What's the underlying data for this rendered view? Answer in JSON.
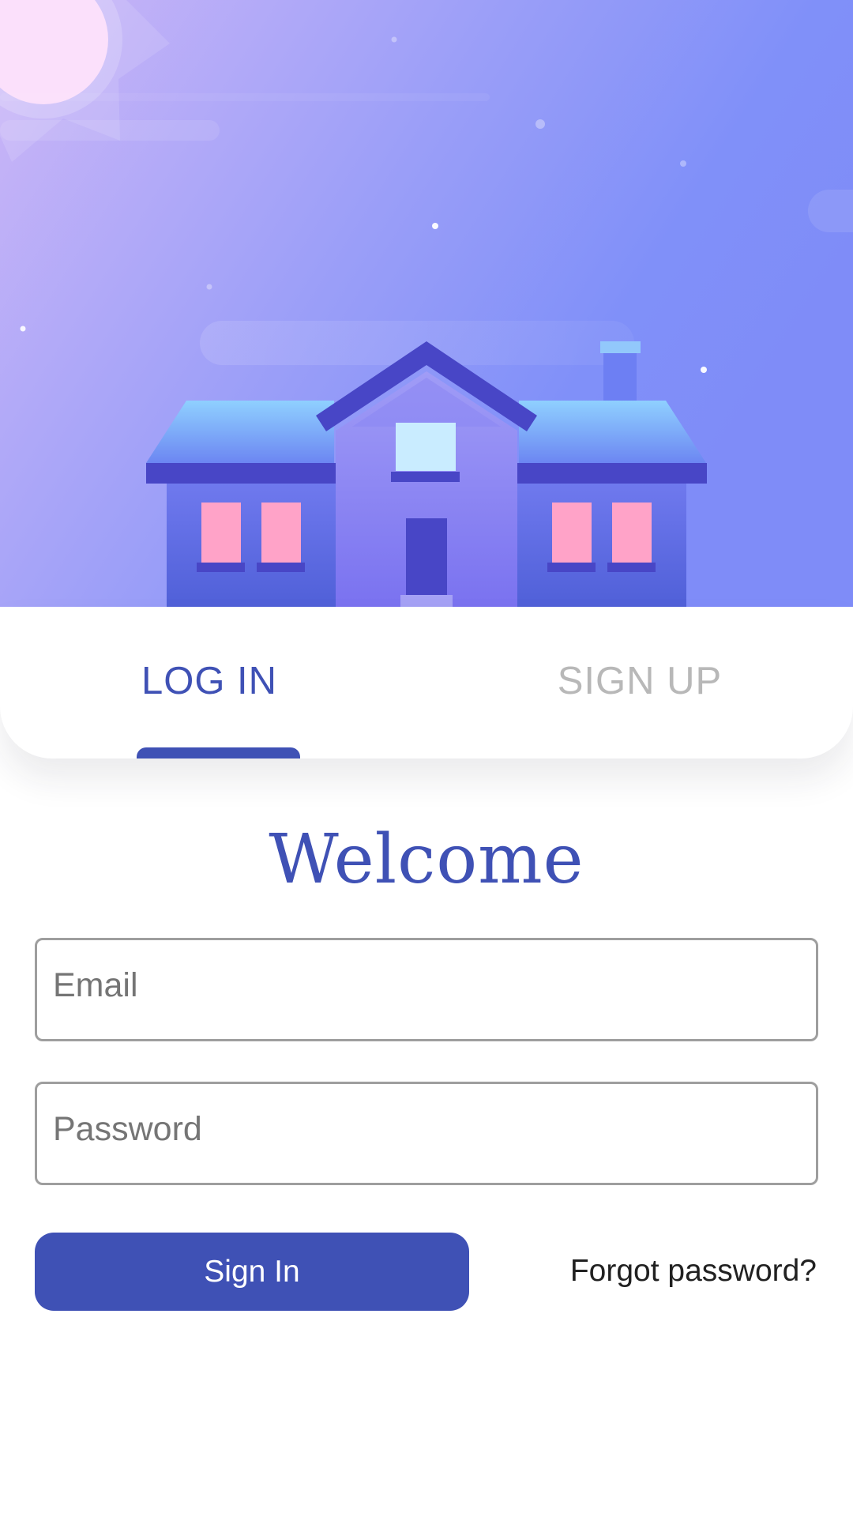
{
  "colors": {
    "accent": "#3f51b5",
    "tab_inactive": "#b8b8b8",
    "hero_sky_top": "#c9b6f7",
    "hero_sky_bottom": "#7f8cf8",
    "window_pink": "#ffa3c8",
    "house_dark": "#4846c6"
  },
  "hero": {
    "illustration": "house-at-dusk-illustration",
    "icons": [
      "sun-icon",
      "house-icon",
      "chimney-icon",
      "star-icon",
      "cloud-icon"
    ]
  },
  "tabs": [
    {
      "label": "LOG IN",
      "active": true
    },
    {
      "label": "SIGN UP",
      "active": false
    }
  ],
  "form": {
    "title": "Welcome",
    "email": {
      "placeholder": "Email",
      "value": ""
    },
    "password": {
      "placeholder": "Password",
      "value": ""
    },
    "submit_label": "Sign In",
    "forgot_label": "Forgot password?"
  }
}
